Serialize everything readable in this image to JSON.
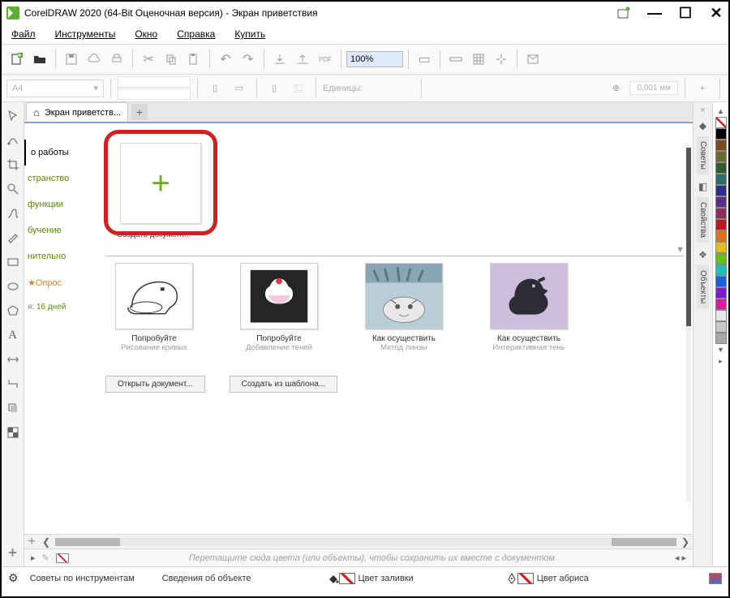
{
  "title": "CorelDRAW 2020 (64-Bit Оценочная версия) - Экран приветствия",
  "menu": {
    "file": "Файл",
    "tools": "Инструменты",
    "window": "Окно",
    "help": "Справка",
    "buy": "Купить"
  },
  "zoom": "100%",
  "propbar": {
    "a4": "A4",
    "units": "Единицы:",
    "dim_value": "0,001 мм"
  },
  "tab": {
    "label": "Экран приветств..."
  },
  "sidebar": {
    "items": [
      {
        "label": "о работы"
      },
      {
        "label": "странство"
      },
      {
        "label": "функции"
      },
      {
        "label": "бучение"
      },
      {
        "label": "нительно"
      },
      {
        "label": "Опрос"
      }
    ],
    "trial_prefix": "я: ",
    "trial": "16 дней"
  },
  "create": {
    "label": "Создать документ..."
  },
  "thumbs": [
    {
      "title": "Попробуйте",
      "sub": "Рисование кривых"
    },
    {
      "title": "Попробуйте",
      "sub": "Добавление теней"
    },
    {
      "title": "Как осуществить",
      "sub": "Метод линзы"
    },
    {
      "title": "Как осуществить",
      "sub": "Интерактивная тень"
    }
  ],
  "buttons": {
    "open": "Открыть документ...",
    "template": "Создать из шаблона..."
  },
  "drop_hint": "Перетащите сюда цвета (или объекты), чтобы сохранить их вместе с документом",
  "status": {
    "tips": "Советы по инструментам",
    "obj": "Сведения об объекте",
    "fill": "Цвет заливки",
    "outline": "Цвет абриса"
  },
  "rpanels": {
    "p1": "Советы",
    "p2": "Свойства",
    "p3": "Объекты"
  },
  "palette": [
    "#000000",
    "#7b4a1e",
    "#6b6b2e",
    "#2e5c2e",
    "#2e6b6b",
    "#2e2e8b",
    "#5b2e8b",
    "#8b2e5b",
    "#c01818",
    "#e07018",
    "#e0c018",
    "#60c018",
    "#18c0c0",
    "#1860e0",
    "#8018e0",
    "#e018a0",
    "#e8e8e8",
    "#c8c8c8",
    "#a8a8a8"
  ]
}
